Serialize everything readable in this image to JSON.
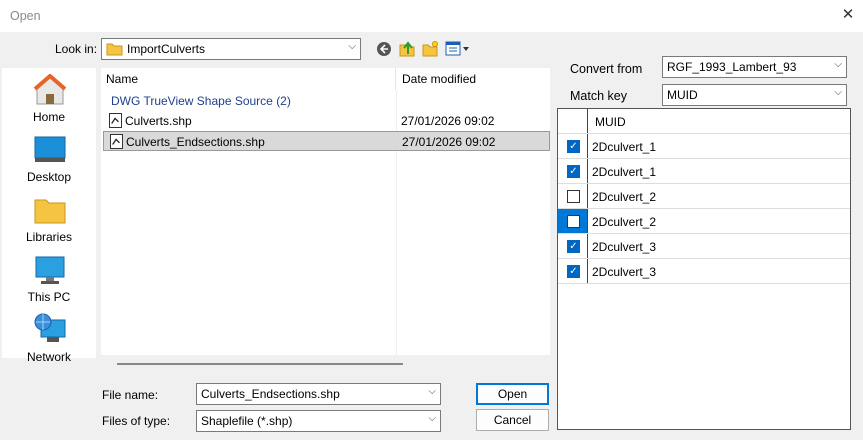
{
  "window": {
    "title": "Open"
  },
  "lookin": {
    "label": "Look in:",
    "value": "ImportCulverts"
  },
  "places": [
    {
      "label": "Home",
      "icon": "home-icon"
    },
    {
      "label": "Desktop",
      "icon": "desktop-icon"
    },
    {
      "label": "Libraries",
      "icon": "libraries-icon"
    },
    {
      "label": "This PC",
      "icon": "this-pc-icon"
    },
    {
      "label": "Network",
      "icon": "network-icon"
    }
  ],
  "filelist": {
    "columns": {
      "name": "Name",
      "date": "Date modified"
    },
    "group": "DWG TrueView Shape Source (2)",
    "files": [
      {
        "name": "Culverts.shp",
        "date": "27/01/2026 09:02",
        "selected": false
      },
      {
        "name": "Culverts_Endsections.shp",
        "date": "27/01/2026 09:02",
        "selected": true
      }
    ]
  },
  "filename": {
    "label": "File name:",
    "value": "Culverts_Endsections.shp"
  },
  "filetype": {
    "label": "Files of type:",
    "value": "Shaplefile (*.shp)"
  },
  "buttons": {
    "open": "Open",
    "cancel": "Cancel"
  },
  "convert": {
    "label": "Convert from",
    "value": "RGF_1993_Lambert_93"
  },
  "matchkey": {
    "label": "Match key",
    "value": "MUID"
  },
  "grid": {
    "header": "MUID",
    "rows": [
      {
        "value": "2Dculvert_1",
        "checked": true
      },
      {
        "value": "2Dculvert_1",
        "checked": true
      },
      {
        "value": "2Dculvert_2",
        "checked": false
      },
      {
        "value": "2Dculvert_2",
        "checked": false
      },
      {
        "value": "2Dculvert_3",
        "checked": true
      },
      {
        "value": "2Dculvert_3",
        "checked": true
      }
    ]
  },
  "colors": {
    "accent": "#0078d7",
    "checked": "#0067c0",
    "group_text": "#1f3f8f"
  }
}
